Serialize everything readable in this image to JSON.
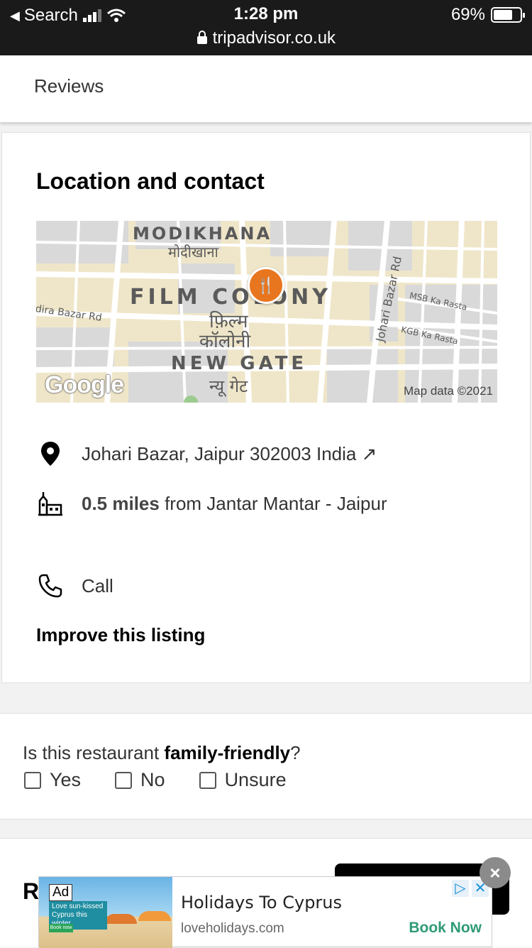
{
  "status_bar": {
    "back_label": "Search",
    "time": "1:28 pm",
    "url": "tripadvisor.co.uk",
    "battery": "69%"
  },
  "tabs": {
    "reviews": "Reviews"
  },
  "location": {
    "title": "Location and contact",
    "map": {
      "labels": {
        "modikhana": "MODIKHANA",
        "modikhana_hi": "मोदीखाना",
        "film_colony": "FILM COLONY",
        "film_colony_hi_1": "फ़िल्म",
        "film_colony_hi_2": "कॉलोनी",
        "new_gate": "NEW GATE",
        "new_gate_hi": "न्यू गेट",
        "indira_rd": "dira Bazar Rd",
        "johari_rd": "Johari Bazar Rd",
        "msb_rasta": "MSB Ka Rasta",
        "kgb_rasta": "KGB Ka Rasta"
      },
      "logo": "Google",
      "attribution": "Map data ©2021"
    },
    "address": "Johari Bazar, Jaipur 302003 India",
    "address_arrow": "↗",
    "distance_bold": "0.5 miles",
    "distance_rest": " from Jantar Mantar - Jaipur",
    "call": "Call",
    "improve": "Improve this listing"
  },
  "family_friendly": {
    "question_start": "Is this restaurant ",
    "question_bold": "family-friendly",
    "question_end": "?",
    "options": [
      "Yes",
      "No",
      "Unsure"
    ]
  },
  "next_section": {
    "title_partial": "R"
  },
  "ad": {
    "badge": "Ad",
    "image_text": "Love sun-kissed Cyprus this winter",
    "image_button": "Book now",
    "title": "Holidays To Cyprus",
    "domain": "loveholidays.com",
    "cta": "Book Now",
    "close": "×"
  }
}
